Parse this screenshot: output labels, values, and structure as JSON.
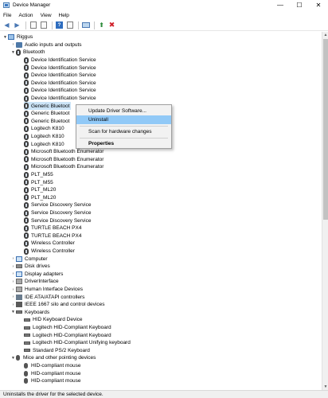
{
  "window": {
    "title": "Device Manager",
    "controls": {
      "minimize": "—",
      "maximize": "☐",
      "close": "✕"
    }
  },
  "menu": [
    "File",
    "Action",
    "View",
    "Help"
  ],
  "toolbar": [
    "back-arrow-icon",
    "forward-arrow-icon",
    "properties-icon",
    "show-hidden-icon",
    "help-icon",
    "properties-sheet-icon",
    "scan-monitor-icon",
    "add-legacy-icon",
    "uninstall-icon"
  ],
  "tree": {
    "root": "Riggus",
    "categories": {
      "audio": "Audio inputs and outputs",
      "bluetooth": "Bluetooth",
      "computer": "Computer",
      "disk": "Disk drives",
      "display": "Display adapters",
      "driverinterface": "DriverInterface",
      "hid": "Human Interface Devices",
      "ide": "IDE ATA/ATAPI controllers",
      "ieee": "IEEE 1667 silo and control devices",
      "keyboards": "Keyboards",
      "mice": "Mice and other pointing devices"
    },
    "bluetooth_items": [
      "Device Identification Service",
      "Device Identification Service",
      "Device Identification Service",
      "Device Identification Service",
      "Device Identification Service",
      "Device Identification Service",
      "Generic Bluetoot",
      "Generic Bluetoot",
      "Generic Bluetoot",
      "Logitech K810",
      "Logitech K810",
      "Logitech K810",
      "Microsoft Bluetooth Enumerator",
      "Microsoft Bluetooth Enumerator",
      "Microsoft Bluetooth Enumerator",
      "PLT_M55",
      "PLT_M55",
      "PLT_ML20",
      "PLT_ML20",
      "Service Discovery Service",
      "Service Discovery Service",
      "Service Discovery Service",
      "TURTLE BEACH PX4",
      "TURTLE BEACH PX4",
      "Wireless Controller",
      "Wireless Controller"
    ],
    "keyboard_items": [
      "HID Keyboard Device",
      "Logitech HID-Compliant Keyboard",
      "Logitech HID-Compliant Keyboard",
      "Logitech HID-Compliant Unifying keyboard",
      "Standard PS/2 Keyboard"
    ],
    "mouse_items": [
      "HID-compliant mouse",
      "HID-compliant mouse",
      "HID-compliant mouse"
    ]
  },
  "context_menu": {
    "update": "Update Driver Software...",
    "uninstall": "Uninstall",
    "scan": "Scan for hardware changes",
    "properties": "Properties"
  },
  "status": "Uninstalls the driver for the selected device."
}
